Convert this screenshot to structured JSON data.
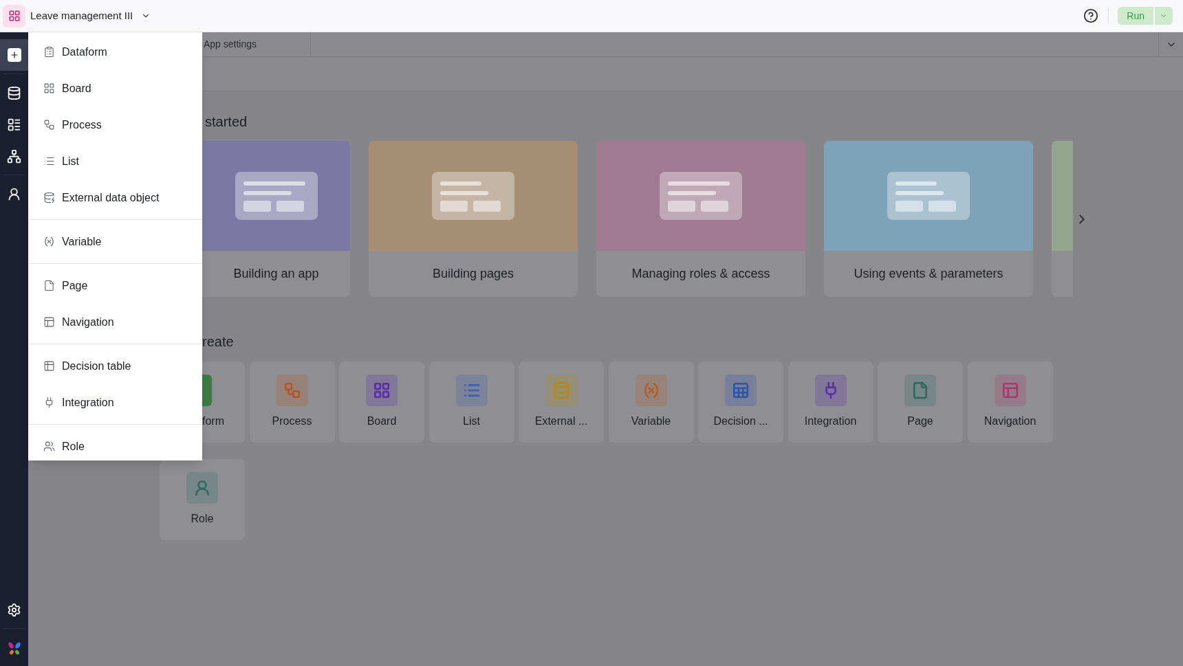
{
  "app_bar": {
    "title": "Leave management III",
    "run_label": "Run"
  },
  "sidebar": {
    "items": [
      {
        "selected": true
      },
      {
        "selected": false
      },
      {
        "selected": false
      },
      {
        "selected": false
      },
      {
        "selected": false
      }
    ]
  },
  "add_menu": {
    "groups": [
      [
        "Dataform",
        "Board",
        "Process",
        "List",
        "External data object"
      ],
      [
        "Variable"
      ],
      [
        "Page",
        "Navigation"
      ],
      [
        "Decision table",
        "Integration"
      ],
      [
        "Role"
      ]
    ]
  },
  "tab": {
    "label": "App settings"
  },
  "get_started": {
    "heading": "started",
    "cards": [
      {
        "title": "Building an app",
        "color": "#7b78a3"
      },
      {
        "title": "Building pages",
        "color": "#a58e74"
      },
      {
        "title": "Managing roles & access",
        "color": "#a07a90"
      },
      {
        "title": "Using events & parameters",
        "color": "#7ea3b8"
      },
      {
        "color": "#93a58c"
      }
    ]
  },
  "create": {
    "heading": "reate",
    "tiles": [
      {
        "label": "form",
        "color": "#3d7a45"
      },
      {
        "label": "Process",
        "color": "#b0582a"
      },
      {
        "label": "Board",
        "color": "#5b2fa8"
      },
      {
        "label": "List",
        "color": "#3b5fb0"
      },
      {
        "label": "External ...",
        "color": "#b08a20"
      },
      {
        "label": "Variable",
        "color": "#b0602a"
      },
      {
        "label": "Decision ...",
        "color": "#2f55a8"
      },
      {
        "label": "Integration",
        "color": "#5a30a8"
      },
      {
        "label": "Page",
        "color": "#2f6a62"
      },
      {
        "label": "Navigation",
        "color": "#a83a6a"
      },
      {
        "label": "Role",
        "color": "#2f6a62"
      }
    ]
  }
}
